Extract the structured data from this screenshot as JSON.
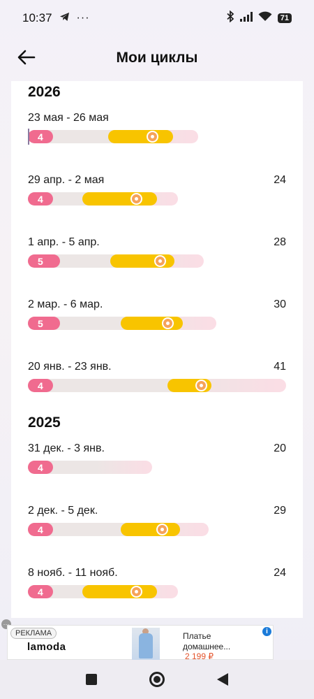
{
  "status": {
    "time": "10:37",
    "dots": "···",
    "battery": "71"
  },
  "header": {
    "title": "Мои циклы"
  },
  "years": [
    {
      "year": "2026",
      "cycles": [
        {
          "dates": "23 мая - 26 мая",
          "length": "",
          "period_days": "4",
          "fertile_start": 0.31,
          "fertile_end": 0.56,
          "ovulation": 0.48,
          "track_fraction": 0.66,
          "today": true
        },
        {
          "dates": "29 апр. - 2 мая",
          "length": "24",
          "period_days": "4",
          "fertile_start": 0.21,
          "fertile_end": 0.5,
          "ovulation": 0.42,
          "track_fraction": 0.58
        },
        {
          "dates": "1 апр. - 5 апр.",
          "length": "28",
          "period_days": "5",
          "fertile_start": 0.32,
          "fertile_end": 0.57,
          "ovulation": 0.51,
          "track_fraction": 0.68
        },
        {
          "dates": "2 мар. - 6 мар.",
          "length": "30",
          "period_days": "5",
          "fertile_start": 0.36,
          "fertile_end": 0.6,
          "ovulation": 0.54,
          "track_fraction": 0.73
        },
        {
          "dates": "20 янв. - 23 янв.",
          "length": "41",
          "period_days": "4",
          "fertile_start": 0.54,
          "fertile_end": 0.71,
          "ovulation": 0.67,
          "track_fraction": 1.0
        }
      ]
    },
    {
      "year": "2025",
      "cycles": [
        {
          "dates": "31 дек. - 3 янв.",
          "length": "20",
          "period_days": "4",
          "fertile_start": null,
          "fertile_end": null,
          "ovulation": null,
          "track_fraction": 0.48
        },
        {
          "dates": "2 дек. - 5 дек.",
          "length": "29",
          "period_days": "4",
          "fertile_start": 0.36,
          "fertile_end": 0.59,
          "ovulation": 0.52,
          "track_fraction": 0.7
        },
        {
          "dates": "8 нояб. - 11 нояб.",
          "length": "24",
          "period_days": "4",
          "fertile_start": 0.21,
          "fertile_end": 0.5,
          "ovulation": 0.42,
          "track_fraction": 0.58
        }
      ]
    }
  ],
  "ad": {
    "label": "РЕКЛАМА",
    "brand": "lamoda",
    "title": "Платье домашнее...",
    "price": "2 199 ₽",
    "info": "i",
    "more": "···"
  },
  "colors": {
    "period": "#f06b8f",
    "fertile": "#f8c400",
    "ovulation": "#f6a35a",
    "track": "#ece6e5"
  },
  "icons": {
    "back": "arrow-left-icon",
    "telegram": "telegram-icon",
    "bluetooth": "bluetooth-icon",
    "signal": "signal-icon",
    "wifi": "wifi-icon",
    "battery": "battery-icon",
    "nav_recent": "square-icon",
    "nav_home": "circle-icon",
    "nav_back": "triangle-back-icon"
  }
}
